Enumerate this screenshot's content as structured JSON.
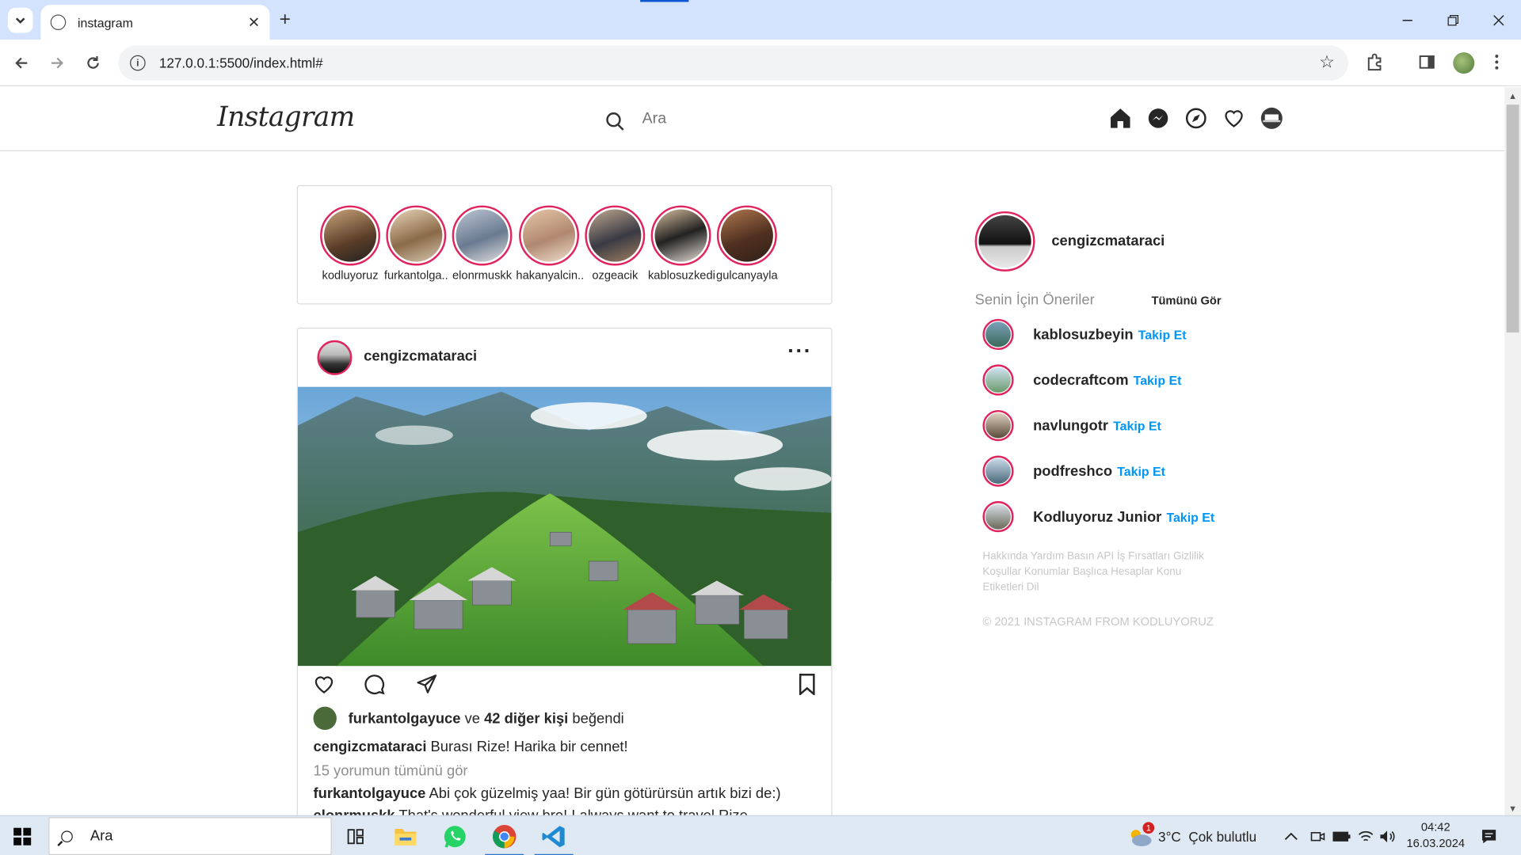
{
  "browser": {
    "tab_title": "instagram",
    "url": "127.0.0.1:5500/index.html#",
    "window_controls": [
      "minimize-icon",
      "restore-icon",
      "close-icon"
    ]
  },
  "ig": {
    "logo": "Instagram",
    "search_placeholder": "Ara",
    "nav_icons": [
      "home-icon",
      "messenger-icon",
      "explore-icon",
      "heart-icon",
      "profile-avatar"
    ]
  },
  "stories": [
    {
      "name": "kodluyoruz"
    },
    {
      "name": "furkantolga.."
    },
    {
      "name": "elonrmuskk"
    },
    {
      "name": "hakanyalcin.."
    },
    {
      "name": "ozgeacik"
    },
    {
      "name": "kablosuzkedi"
    },
    {
      "name": "gulcanyayla"
    }
  ],
  "post": {
    "username": "cengizcmataraci",
    "liked_by_user": "furkantolgayuce",
    "liked_and": "ve",
    "liked_others": "42 diğer kişi",
    "liked_suffix": "beğendi",
    "caption_user": "cengizcmataraci",
    "caption_text": "Burası Rize! Harika bir cennet!",
    "view_comments": "15 yorumun tümünü gör",
    "comments": [
      {
        "user": "furkantolgayuce",
        "text": "Abi çok güzelmiş yaa! Bir gün götürürsün artık bizi de:)"
      },
      {
        "user": "elonrmuskk",
        "text": "That's wonderful view bro! I always want to travel Rize"
      }
    ]
  },
  "sidebar": {
    "me": "cengizcmataraci",
    "suggestions_title": "Senin İçin Öneriler",
    "see_all": "Tümünü Gör",
    "follow_label": "Takip Et",
    "suggestions": [
      {
        "name": "kablosuzbeyin"
      },
      {
        "name": "codecraftcom"
      },
      {
        "name": "navlungotr"
      },
      {
        "name": "podfreshco"
      },
      {
        "name": "Kodluyoruz Junior"
      }
    ],
    "footer_links": "Hakkında Yardım Basın API İş Fırsatları Gizlilik Koşullar Konumlar Başlıca Hesaplar Konu Etiketleri Dil",
    "copyright": "© 2021 INSTAGRAM FROM KODLUYORUZ"
  },
  "taskbar": {
    "search": "Ara",
    "weather_temp": "3°C",
    "weather_text": "Çok bulutlu",
    "weather_badge": "1",
    "time": "04:42",
    "date": "16.03.2024",
    "apps": [
      "task-view-icon",
      "file-explorer-icon",
      "whatsapp-icon",
      "chrome-icon",
      "vscode-icon"
    ]
  },
  "colors": {
    "story_ring": "#e0245e",
    "follow_link": "#0095f6",
    "chrome_tabbar": "#d3e3fd",
    "taskbar": "#dfe9f3"
  }
}
